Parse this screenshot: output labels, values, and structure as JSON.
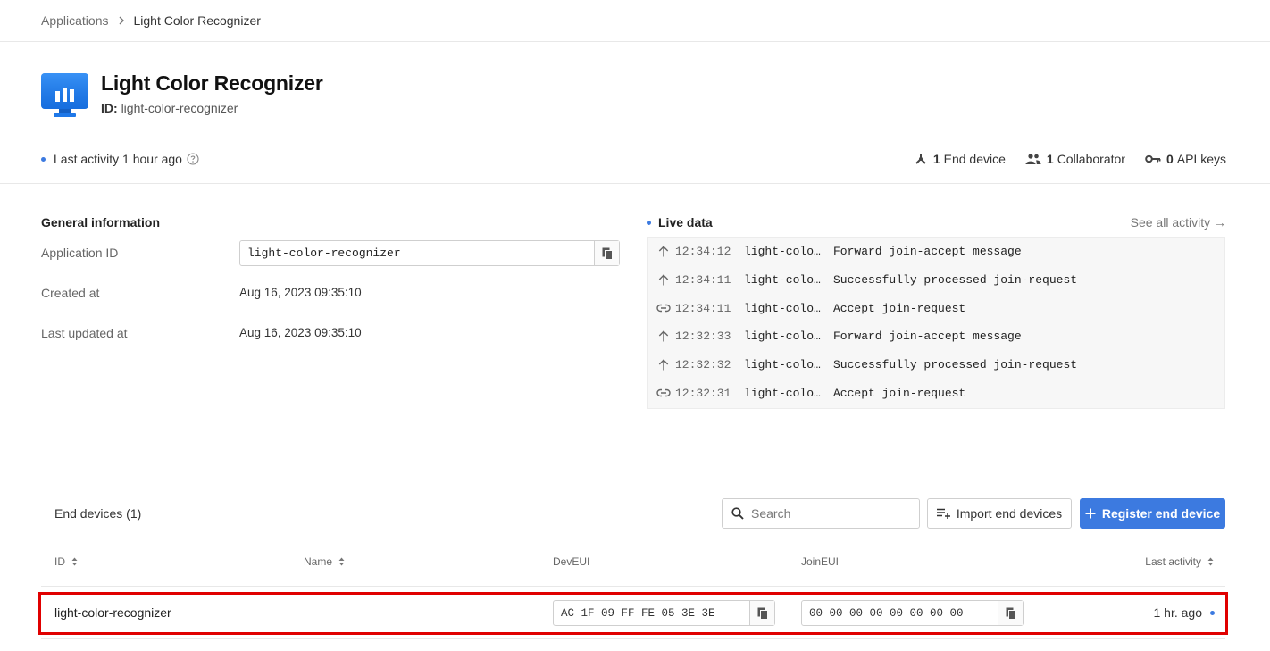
{
  "breadcrumb": {
    "parent": "Applications",
    "current": "Light Color Recognizer"
  },
  "app": {
    "title": "Light Color Recognizer",
    "id_label": "ID:",
    "id_value": "light-color-recognizer",
    "last_activity": "Last activity 1 hour ago",
    "stats": {
      "end_devices_count": "1",
      "end_devices_label": "End device",
      "collaborators_count": "1",
      "collaborators_label": "Collaborator",
      "api_keys_count": "0",
      "api_keys_label": "API keys"
    }
  },
  "general_info": {
    "title": "General information",
    "application_id_label": "Application ID",
    "application_id_value": "light-color-recognizer",
    "created_at_label": "Created at",
    "created_at_value": "Aug 16, 2023 09:35:10",
    "last_updated_label": "Last updated at",
    "last_updated_value": "Aug 16, 2023 09:35:10"
  },
  "live_data": {
    "title": "Live data",
    "see_all": "See all activity →",
    "events": [
      {
        "icon": "arrow-up-icon",
        "time": "12:34:12",
        "device": "light-colo…",
        "message": "Forward join-accept message"
      },
      {
        "icon": "arrow-up-icon",
        "time": "12:34:11",
        "device": "light-colo…",
        "message": "Successfully processed join-request"
      },
      {
        "icon": "link-icon",
        "time": "12:34:11",
        "device": "light-colo…",
        "message": "Accept join-request"
      },
      {
        "icon": "arrow-up-icon",
        "time": "12:32:33",
        "device": "light-colo…",
        "message": "Forward join-accept message"
      },
      {
        "icon": "arrow-up-icon",
        "time": "12:32:32",
        "device": "light-colo…",
        "message": "Successfully processed join-request"
      },
      {
        "icon": "link-icon",
        "time": "12:32:31",
        "device": "light-colo…",
        "message": "Accept join-request"
      }
    ]
  },
  "end_devices": {
    "title": "End devices (1)",
    "search_placeholder": "Search",
    "import_label": "Import end devices",
    "register_label": "Register end device",
    "columns": {
      "id": "ID",
      "name": "Name",
      "deveui": "DevEUI",
      "joineui": "JoinEUI",
      "last_activity": "Last activity"
    },
    "rows": [
      {
        "id": "light-color-recognizer",
        "name": "",
        "deveui": "AC 1F 09 FF FE 05 3E 3E",
        "joineui": "00 00 00 00 00 00 00 00",
        "last_activity": "1 hr. ago"
      }
    ]
  },
  "colors": {
    "accent": "#3c7ae0",
    "highlight": "#e00000"
  }
}
